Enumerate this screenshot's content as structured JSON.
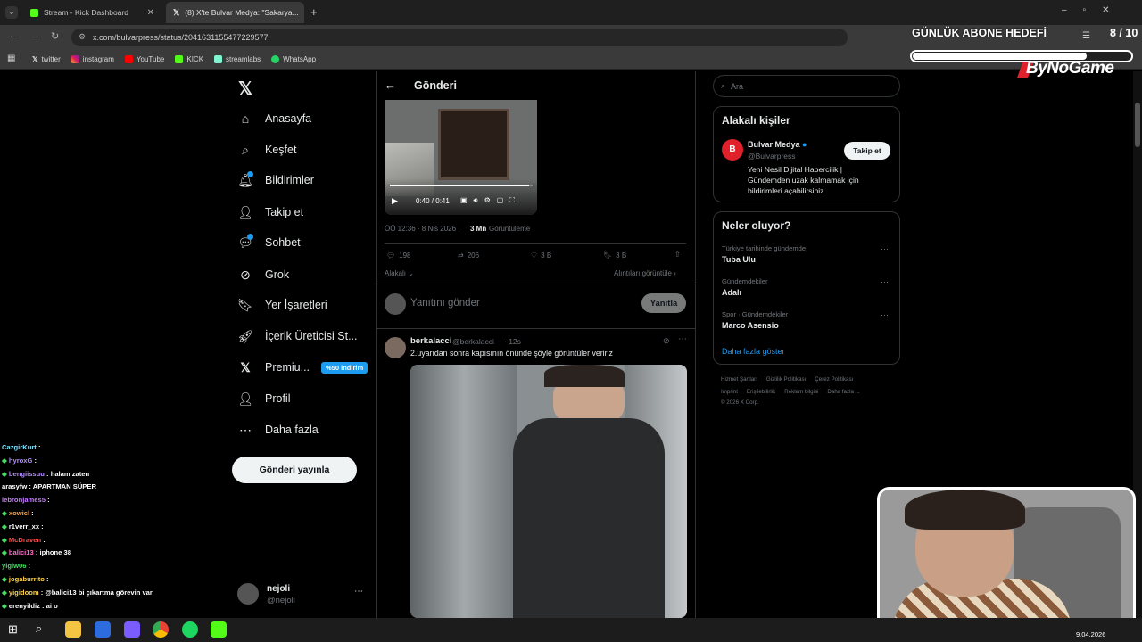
{
  "browser": {
    "tabs": [
      {
        "title": "Stream - Kick Dashboard",
        "active": false
      },
      {
        "title": "(8) X'te Bulvar Medya: \"Sakarya...",
        "active": true
      }
    ],
    "url": "x.com/bulvarpress/status/2041631155477229577",
    "bookmarks": [
      "twitter",
      "instagram",
      "YouTube",
      "KICK",
      "streamlabs",
      "WhatsApp"
    ]
  },
  "overlay": {
    "goal_label": "GÜNLÜK ABONE HEDEFİ",
    "goal_count": "8 / 10",
    "goal_progress": 0.8,
    "brand": "ByNoGame"
  },
  "x_nav": {
    "items": [
      "Anasayfa",
      "Keşfet",
      "Bildirimler",
      "Takip et",
      "Sohbet",
      "Grok",
      "Yer İşaretleri",
      "İçerik Üreticisi St...",
      "Premiu...",
      "Profil",
      "Daha fazla"
    ],
    "premium_badge": "%50 indirim",
    "post_button": "Gönderi yayınla",
    "account_name": "nejoli",
    "account_handle": "@nejoli"
  },
  "post": {
    "header": "Gönderi",
    "video_time": "0:40 / 0:41",
    "timestamp": "ÖÖ 12:36 · 8 Nis 2026 ·",
    "views_count": "3 Mn",
    "views_label": "Görüntüleme",
    "replies": "198",
    "reposts": "206",
    "likes": "3 B",
    "bookmarks": "3 B",
    "sort_label": "Alakalı",
    "quotes_link": "Alıntıları görüntüle",
    "reply_placeholder": "Yanıtını gönder",
    "reply_button": "Yanıtla"
  },
  "reply": {
    "name": "berkalacci",
    "handle": "@berkalacci",
    "age": "· 12s",
    "text": "2.uyarıdan sonra kapısının önünde şöyle görüntüler veririz"
  },
  "sidebar": {
    "search_placeholder": "Ara",
    "related_title": "Alakalı kişiler",
    "related_name": "Bulvar Medya",
    "related_handle": "@Bulvarpress",
    "related_bio": "Yeni Nesil Dijital Habercilik | Gündemden uzak kalmamak için bildirimleri açabilirsiniz.",
    "follow_button": "Takip et",
    "trends_title": "Neler oluyor?",
    "trends": [
      {
        "context": "Türkiye tarihinde gündemde",
        "name": "Tuba Ulu"
      },
      {
        "context": "Gündemdekiler",
        "name": "Adalı"
      },
      {
        "context": "Spor · Gündemdekiler",
        "name": "Marco Asensio"
      }
    ],
    "show_more": "Daha fazla göster",
    "footer_row1": [
      "Hizmet Şartları",
      "Gizlilik Politikası",
      "Çerez Politikası"
    ],
    "footer_row2": [
      "Imprint",
      "Erişilebilirlik",
      "Reklam bilgisi",
      "Daha fazla ..."
    ],
    "copyright": "© 2026 X Corp."
  },
  "chat": [
    {
      "user": "CazgirKurt",
      "msg": "",
      "color": "#7ee0ff",
      "badge": false
    },
    {
      "user": "hyroxG",
      "msg": "",
      "color": "#b48cff",
      "badge": true
    },
    {
      "user": "bengiissuu",
      "msg": "halam zaten",
      "color": "#b48cff",
      "badge": true
    },
    {
      "user": "arasyfw",
      "msg": "APARTMAN SÜPER",
      "color": "#ffffff",
      "badge": false
    },
    {
      "user": "lebronjames5",
      "msg": "",
      "color": "#c77dff",
      "badge": false
    },
    {
      "user": "xowicl",
      "msg": "",
      "color": "#ff9f43",
      "badge": true
    },
    {
      "user": "r1verr_xx",
      "msg": "",
      "color": "#ffffff",
      "badge": true
    },
    {
      "user": "McDraven",
      "msg": "",
      "color": "#ff4d4d",
      "badge": true
    },
    {
      "user": "balici13",
      "msg": "iphone 38",
      "color": "#ff6bcb",
      "badge": true
    },
    {
      "user": "yigiw06",
      "msg": "",
      "color": "#4cd964",
      "badge": false
    },
    {
      "user": "jogaburrito",
      "msg": "",
      "color": "#ffd24d",
      "badge": true
    },
    {
      "user": "yigidoom",
      "msg": "@balici13 bi çıkartma görevin var",
      "color": "#ffd24d",
      "badge": true
    },
    {
      "user": "erenyildiz",
      "msg": "ai o",
      "color": "#ffffff",
      "badge": true
    }
  ],
  "taskbar": {
    "date": "9.04.2026"
  }
}
